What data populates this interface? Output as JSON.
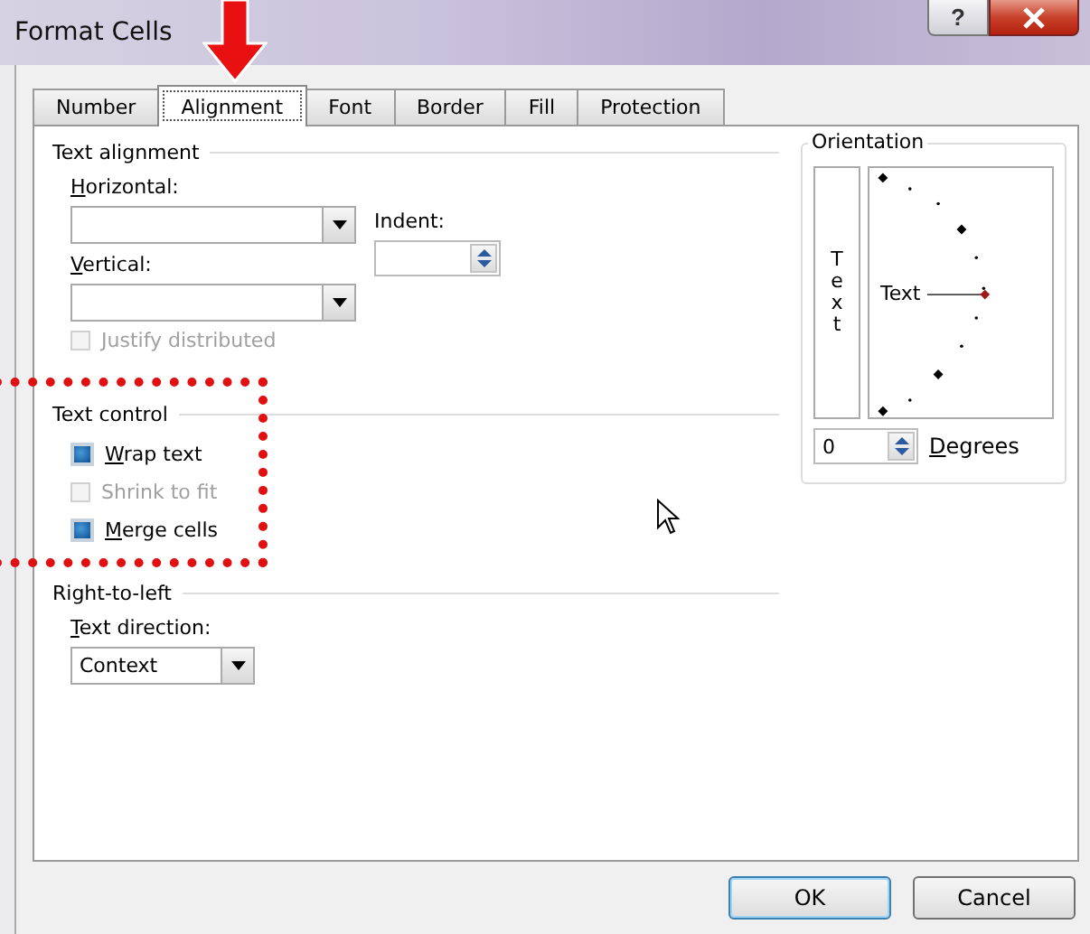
{
  "window": {
    "title": "Format Cells",
    "help": "?"
  },
  "tabs": [
    {
      "label": "Number",
      "selected": false
    },
    {
      "label": "Alignment",
      "selected": true
    },
    {
      "label": "Font",
      "selected": false
    },
    {
      "label": "Border",
      "selected": false
    },
    {
      "label": "Fill",
      "selected": false
    },
    {
      "label": "Protection",
      "selected": false
    }
  ],
  "text_alignment": {
    "title": "Text alignment",
    "horizontal": {
      "label": "Horizontal:"
    },
    "vertical": {
      "label": "Vertical:"
    },
    "indent": {
      "label": "Indent:"
    },
    "justify": {
      "label": "Justify distributed",
      "checked": false,
      "disabled": true
    }
  },
  "text_control": {
    "title": "Text control",
    "options": [
      {
        "label": "Wrap text",
        "checked": true,
        "disabled": false
      },
      {
        "label": "Shrink to fit",
        "checked": false,
        "disabled": true
      },
      {
        "label": "Merge cells",
        "checked": true,
        "disabled": false
      }
    ]
  },
  "right_to_left": {
    "title": "Right-to-left",
    "direction": {
      "label": "Text direction:",
      "value": "Context"
    }
  },
  "orientation": {
    "title": "Orientation",
    "vertical_text": "Text",
    "dial_text": "Text",
    "degrees": "0",
    "degrees_label": "Degrees"
  },
  "buttons": [
    {
      "label": "OK",
      "default": true
    },
    {
      "label": "Cancel",
      "default": false
    }
  ]
}
